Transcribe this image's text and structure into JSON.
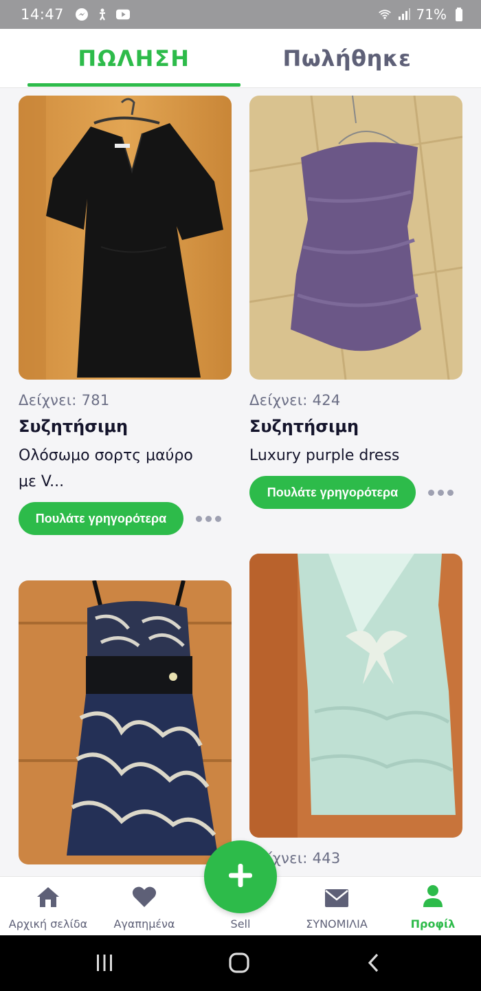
{
  "status_bar": {
    "time": "14:47",
    "battery": "71%",
    "left_icons": [
      "messenger-icon",
      "accessibility-icon",
      "youtube-icon"
    ],
    "right_icons": [
      "wifi-icon",
      "signal-icon",
      "battery-icon"
    ]
  },
  "tabs": [
    {
      "label": "ΠΩΛΗΣΗ",
      "active": true
    },
    {
      "label": "Πωλήθηκε",
      "active": false
    }
  ],
  "listings": [
    {
      "image": "black-dress-photo",
      "views": "Δείχνει: 781",
      "tag": "Συζητήσιμη",
      "title_line1": "Ολόσωμο σορτς μαύρο",
      "title_line2": "με V...",
      "boost_label": "Πουλάτε γρηγορότερα"
    },
    {
      "image": "purple-dress-photo",
      "views": "Δείχνει: 424",
      "tag": "Συζητήσιμη",
      "title_line1": "Luxury purple dress",
      "title_line2": "",
      "boost_label": "Πουλάτε γρηγορότερα"
    },
    {
      "image": "lace-dress-photo",
      "views": "",
      "tag": "",
      "title_line1": "",
      "title_line2": "",
      "boost_label": ""
    },
    {
      "image": "mint-lace-dress-photo",
      "views": "Δείχνει: 443",
      "tag": "",
      "title_line1": "",
      "title_line2": "",
      "boost_label": ""
    }
  ],
  "fab": {
    "icon": "plus-icon"
  },
  "bottom_nav": [
    {
      "label": "Αρχική σελίδα",
      "icon": "home-icon",
      "active": false
    },
    {
      "label": "Αγαπημένα",
      "icon": "heart-icon",
      "active": false
    },
    {
      "label": "Sell",
      "icon": "plus-icon",
      "active": false
    },
    {
      "label": "ΣΥΝΟΜΙΛΙΑ",
      "icon": "mail-icon",
      "active": false
    },
    {
      "label": "Προφίλ",
      "icon": "profile-icon",
      "active": true
    }
  ],
  "system_nav": [
    "recents-icon",
    "home-circle-icon",
    "back-icon"
  ],
  "colors": {
    "accent": "#2dbb4a",
    "text_dark": "#14142b",
    "text_muted": "#6a6d84",
    "status_bar_bg": "#9a9a9c"
  }
}
